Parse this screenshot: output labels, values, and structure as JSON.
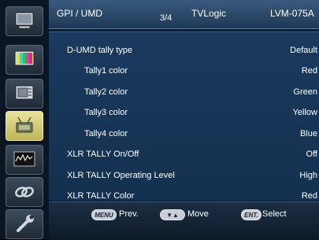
{
  "header": {
    "section": "GPI / UMD",
    "page": "3/4",
    "brand": "TVLogic",
    "model": "LVM-075A"
  },
  "sidebar": {
    "items": [
      {
        "icon": "monitor-icon"
      },
      {
        "icon": "color-bars-icon"
      },
      {
        "icon": "screen-settings-icon"
      },
      {
        "icon": "gpi-tally-icon",
        "active": true
      },
      {
        "icon": "waveform-icon"
      },
      {
        "icon": "link-icon"
      },
      {
        "icon": "wrench-icon"
      }
    ]
  },
  "menu": {
    "rows": [
      {
        "label": "D-UMD tally type",
        "value": "Default"
      },
      {
        "label": "Tally1 color",
        "value": "Red"
      },
      {
        "label": "Tally2 color",
        "value": "Green"
      },
      {
        "label": "Tally3 color",
        "value": "Yellow"
      },
      {
        "label": "Tally4 color",
        "value": "Blue"
      },
      {
        "label": "XLR TALLY On/Off",
        "value": "Off"
      },
      {
        "label": "XLR TALLY Operating Level",
        "value": "High"
      },
      {
        "label": "XLR TALLY Color",
        "value": "Red"
      }
    ]
  },
  "footer": {
    "menu_key": "MENU",
    "menu_label": "Prev.",
    "move_key": "▼▲",
    "move_label": "Move",
    "enter_key": "ENT.",
    "enter_label": "Select"
  }
}
